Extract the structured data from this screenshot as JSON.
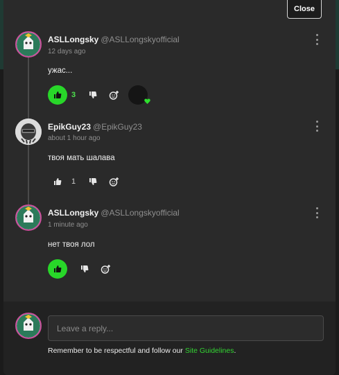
{
  "header": {
    "close_label": "Close"
  },
  "comments": [
    {
      "name": "ASLLongsky",
      "handle": "@ASLLongskyofficial",
      "time": "12 days ago",
      "text": "ужас...",
      "likes": "3",
      "liked": true
    },
    {
      "name": "EpikGuy23",
      "handle": "@EpikGuy23",
      "time": "about 1 hour ago",
      "text": "твоя мать шалава",
      "likes": "1",
      "liked": false
    },
    {
      "name": "ASLLongsky",
      "handle": "@ASLLongskyofficial",
      "time": "1 minute ago",
      "text": "нет твоя лол",
      "likes": "",
      "liked": true
    }
  ],
  "reply": {
    "placeholder": "Leave a reply...",
    "guidelines_prefix": "Remember to be respectful and follow our ",
    "guidelines_link": "Site Guidelines",
    "guidelines_suffix": "."
  },
  "colors": {
    "accent": "#28d629",
    "panel": "#2a2a2a",
    "text_muted": "#8f8f8f"
  },
  "icons": [
    "thumbs-up-icon",
    "thumbs-down-icon",
    "add-reaction-icon",
    "more-vertical-icon",
    "heart-icon"
  ]
}
